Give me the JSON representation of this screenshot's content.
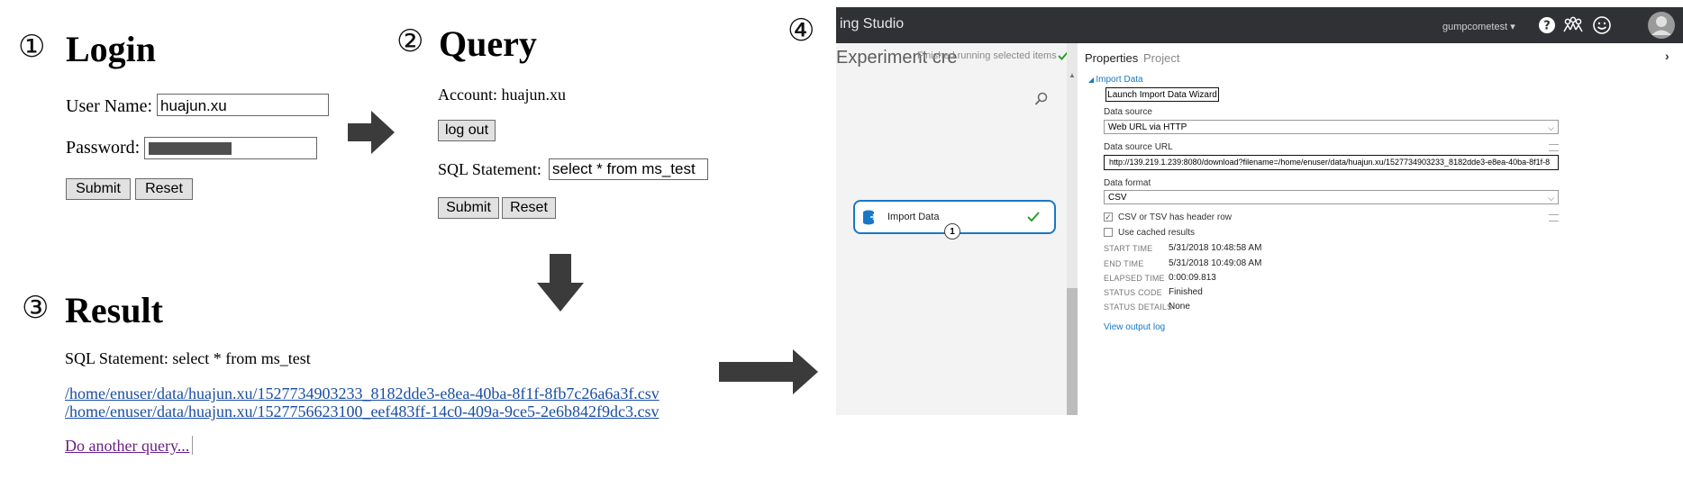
{
  "steps": {
    "s1": {
      "num": "①",
      "title": "Login"
    },
    "s2": {
      "num": "②",
      "title": "Query"
    },
    "s3": {
      "num": "③",
      "title": "Result"
    },
    "s4": {
      "num": "④"
    }
  },
  "login": {
    "username_label": "User Name:",
    "username_value": "huajun.xu",
    "password_label": "Password:",
    "submit": "Submit",
    "reset": "Reset"
  },
  "query": {
    "account_label": "Account: huajun.xu",
    "logout": "log out",
    "sql_label": "SQL Statement:",
    "sql_value": "select * from ms_test",
    "submit": "Submit",
    "reset": "Reset"
  },
  "result": {
    "sql_line": "SQL Statement: select * from ms_test",
    "links": [
      "/home/enuser/data/huajun.xu/1527734903233_8182dde3-e8ea-40ba-8f1f-8fb7c26a6a3f.csv",
      "/home/enuser/data/huajun.xu/1527756623100_eef483ff-14c0-409a-9ce5-2e6b842f9dc3.csv"
    ],
    "another": "Do another query..."
  },
  "studio": {
    "app_title": "ing Studio",
    "user": "gumpcometest",
    "left_title": "Experiment cre",
    "left_overlay": "Finished running selected items",
    "module_name": "Import Data",
    "module_port": "1",
    "tabs": [
      "Properties",
      "Project"
    ],
    "section": "Import Data",
    "launch_button": "Launch Import Data Wizard",
    "data_source_label": "Data source",
    "data_source_value": "Web URL via HTTP",
    "url_label": "Data source URL",
    "url_value": "http://139.219.1.239:8080/download?filename=/home/enuser/data/huajun.xu/1527734903233_8182dde3-e8ea-40ba-8f1f-8",
    "format_label": "Data format",
    "format_value": "CSV",
    "checkbox1": "CSV or TSV has header row",
    "checkbox2": "Use cached results",
    "stats": [
      {
        "k": "START TIME",
        "v": "5/31/2018 10:48:58 AM"
      },
      {
        "k": "END TIME",
        "v": "5/31/2018 10:49:08 AM"
      },
      {
        "k": "ELAPSED TIME",
        "v": "0:00:09.813"
      },
      {
        "k": "STATUS CODE",
        "v": "Finished"
      },
      {
        "k": "STATUS DETAILS",
        "v": "None"
      }
    ],
    "view_log": "View output log"
  },
  "colors": {
    "arrow": "#3b3b3b",
    "link": "#1a4ea2",
    "visited": "#6a1f86",
    "studio_blue": "#1778c6",
    "success": "#2e9b2e"
  }
}
